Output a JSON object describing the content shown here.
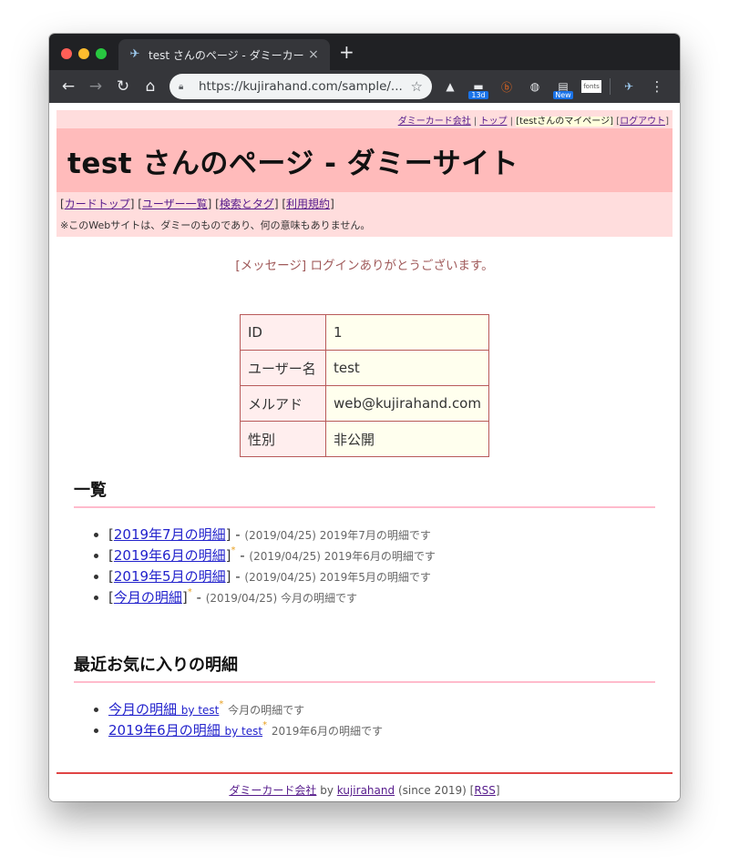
{
  "browser": {
    "tab_title": "test さんのページ - ダミーカード",
    "tab_close": "×",
    "new_tab": "+",
    "url": "https://kujirahand.com/sample/...",
    "extensions": [
      {
        "name": "drive-icon",
        "glyph": "▲",
        "badge": ""
      },
      {
        "name": "calendar-icon",
        "glyph": "▬",
        "badge": "13d"
      },
      {
        "name": "hatena-icon",
        "glyph": "ⓑ",
        "badge": ""
      },
      {
        "name": "keep-icon",
        "glyph": "◍",
        "badge": ""
      },
      {
        "name": "new-extension-icon",
        "glyph": "▤",
        "badge": "New"
      },
      {
        "name": "fonts-icon",
        "glyph": "fonts",
        "badge": ""
      }
    ]
  },
  "site": {
    "topnav": {
      "company": "ダミーカード会社",
      "top": "トップ",
      "mypage": "[testさんのマイページ]",
      "logout": "ログアウト"
    },
    "title": "test さんのページ - ダミーサイト",
    "subnav": {
      "card_top": "カードトップ",
      "user_list": "ユーザー一覧",
      "search_tags": "検索とタグ",
      "terms": "利用規約"
    },
    "disclaimer": "※このWebサイトは、ダミーのものであり、何の意味もありません。",
    "message": "[メッセージ] ログインありがとうございます。"
  },
  "profile": [
    {
      "key": "ID",
      "value": "1"
    },
    {
      "key": "ユーザー名",
      "value": "test"
    },
    {
      "key": "メルアド",
      "value": "web@kujirahand.com"
    },
    {
      "key": "性別",
      "value": "非公開"
    }
  ],
  "list_section": {
    "title": "一覧",
    "items": [
      {
        "link": "2019年7月の明細",
        "starred": false,
        "meta": "(2019/04/25) 2019年7月の明細です"
      },
      {
        "link": "2019年6月の明細",
        "starred": true,
        "meta": "(2019/04/25) 2019年6月の明細です"
      },
      {
        "link": "2019年5月の明細",
        "starred": false,
        "meta": "(2019/04/25) 2019年5月の明細です"
      },
      {
        "link": "今月の明細",
        "starred": true,
        "meta": "(2019/04/25) 今月の明細です"
      }
    ]
  },
  "favorites_section": {
    "title": "最近お気に入りの明細",
    "items": [
      {
        "link": "今月の明細",
        "by": "by test",
        "meta": "今月の明細です"
      },
      {
        "link": "2019年6月の明細",
        "by": "by test",
        "meta": "2019年6月の明細です"
      }
    ]
  },
  "footer": {
    "company": "ダミーカード会社",
    "by": "by",
    "author": "kujirahand",
    "since": "(since 2019)",
    "rss": "RSS"
  }
}
